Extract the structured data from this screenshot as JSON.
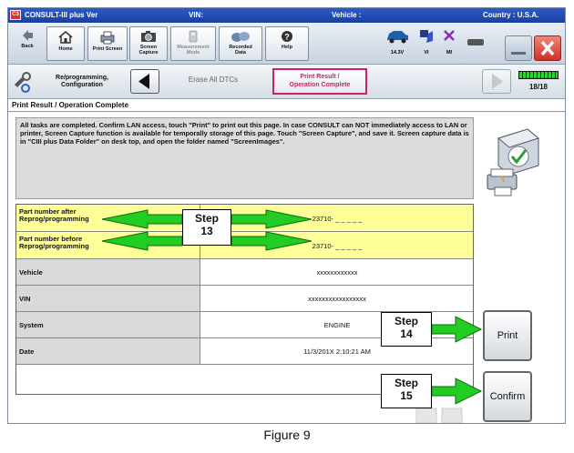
{
  "titlebar": {
    "app_name": "CONSULT-III plus  Ver",
    "vin_label": "VIN:",
    "vehicle_label": "Vehicle :",
    "country_label": "Country : U.S.A."
  },
  "toolbar": {
    "back": "Back",
    "home": "Home",
    "print_screen": "Print Screen",
    "screen_capture_1": "Screen",
    "screen_capture_2": "Capture",
    "measurement_1": "Measurement",
    "measurement_2": "Mode",
    "recorded_1": "Recorded",
    "recorded_2": "Data",
    "help": "Help",
    "battery_voltage": "14.3V",
    "vi_label": "VI",
    "mi_label": "MI"
  },
  "navbar": {
    "reprog_1": "Re/programming,",
    "reprog_2": "Configuration",
    "erase_all_dtcs": "Erase All DTCs",
    "print_result_1": "Print Result /",
    "print_result_2": "Operation Complete",
    "page_indicator": "18/18"
  },
  "subtitle": "Print Result / Operation Complete",
  "message": "All tasks are completed. Confirm LAN access, touch \"Print\" to print out this page. In case CONSULT can NOT immediately access to LAN or printer, Screen Capture function is available for temporally storage of this page. Touch \"Screen Capture\", and save it. Screen capture data is in \"CIII plus Data Folder\" on desk top, and open the folder named \"ScreenImages\".",
  "table": {
    "part_after_label_1": "Part number after",
    "part_after_label_2": "Reprog/programming",
    "part_after_value": "23710-  _ _ _ _ _",
    "part_before_label_1": "Part number before",
    "part_before_label_2": "Reprog/programming",
    "part_before_value": "23710-  _ _ _ _ _",
    "vehicle_label": "Vehicle",
    "vehicle_value": "xxxxxxxxxxxx",
    "vin_label": "VIN",
    "vin_value": "xxxxxxxxxxxxxxxxx",
    "system_label": "System",
    "system_value": "ENGINE",
    "date_label": "Date",
    "date_value": "11/3/201X 2:10:21 AM"
  },
  "buttons": {
    "print": "Print",
    "confirm": "Confirm"
  },
  "callouts": {
    "step13_a": "Step",
    "step13_b": "13",
    "step14_a": "Step",
    "step14_b": "14",
    "step15_a": "Step",
    "step15_b": "15"
  },
  "figure_caption": "Figure 9",
  "colors": {
    "titlebar": "#1a3f9e",
    "highlight_row": "#ffff99",
    "arrow_green": "#22cc22",
    "active_tab_border": "#cc2266",
    "close_red": "#d9342b"
  }
}
